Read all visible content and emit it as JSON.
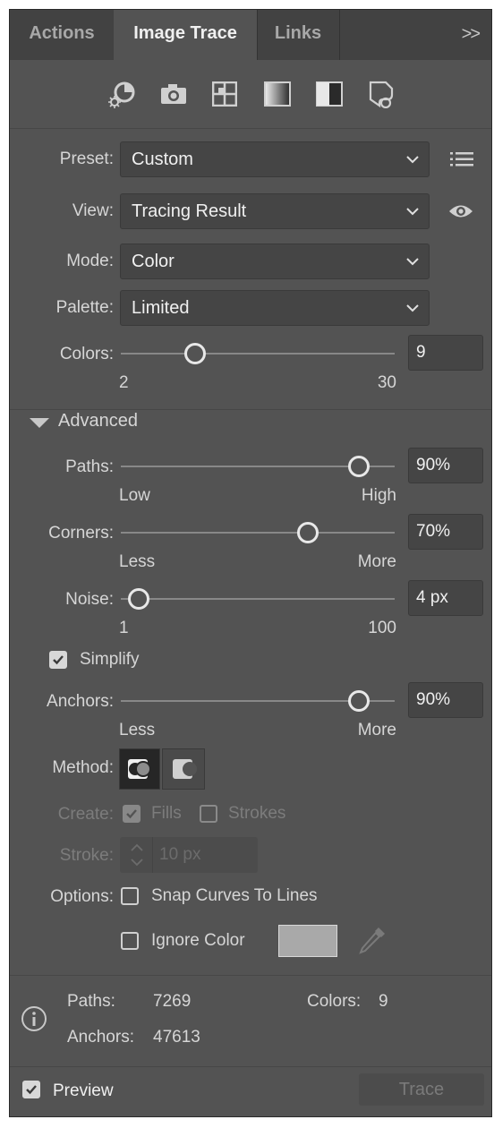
{
  "tabs": [
    {
      "label": "Actions",
      "active": false
    },
    {
      "label": "Image Trace",
      "active": true
    },
    {
      "label": "Links",
      "active": false
    }
  ],
  "tab_overflow": ">>",
  "preset_icons": [
    "auto-color-icon",
    "high-color-icon",
    "low-color-icon",
    "grayscale-icon",
    "black-and-white-icon",
    "outline-icon"
  ],
  "preset": {
    "label": "Preset:",
    "value": "Custom"
  },
  "view": {
    "label": "View:",
    "value": "Tracing Result"
  },
  "mode": {
    "label": "Mode:",
    "value": "Color"
  },
  "palette": {
    "label": "Palette:",
    "value": "Limited"
  },
  "colors": {
    "label": "Colors:",
    "value": "9",
    "min": "2",
    "max": "30",
    "level": 0.25
  },
  "advanced": {
    "label": "Advanced",
    "expanded": true
  },
  "paths": {
    "label": "Paths:",
    "value": "90%",
    "min": "Low",
    "max": "High",
    "level": 0.9
  },
  "corners": {
    "label": "Corners:",
    "value": "70%",
    "min": "Less",
    "max": "More",
    "level": 0.7
  },
  "noise": {
    "label": "Noise:",
    "value": "4 px",
    "min": "1",
    "max": "100",
    "level": 0.03
  },
  "simplify": {
    "label": "Simplify",
    "checked": true
  },
  "anchors": {
    "label": "Anchors:",
    "value": "90%",
    "min": "Less",
    "max": "More",
    "level": 0.9
  },
  "method": {
    "label": "Method:"
  },
  "create": {
    "label": "Create:",
    "fills": "Fills",
    "strokes": "Strokes",
    "fills_checked": true,
    "strokes_checked": false
  },
  "stroke": {
    "label": "Stroke:",
    "value": "10 px"
  },
  "options": {
    "label": "Options:",
    "snap": "Snap Curves To Lines",
    "ignore": "Ignore Color",
    "ignore_swatch": "#a9a9a9"
  },
  "stats": {
    "paths_label": "Paths:",
    "paths_value": "7269",
    "colors_label": "Colors:",
    "colors_value": "9",
    "anchors_label": "Anchors:",
    "anchors_value": "47613"
  },
  "preview": {
    "label": "Preview",
    "checked": true
  },
  "trace_button": "Trace"
}
